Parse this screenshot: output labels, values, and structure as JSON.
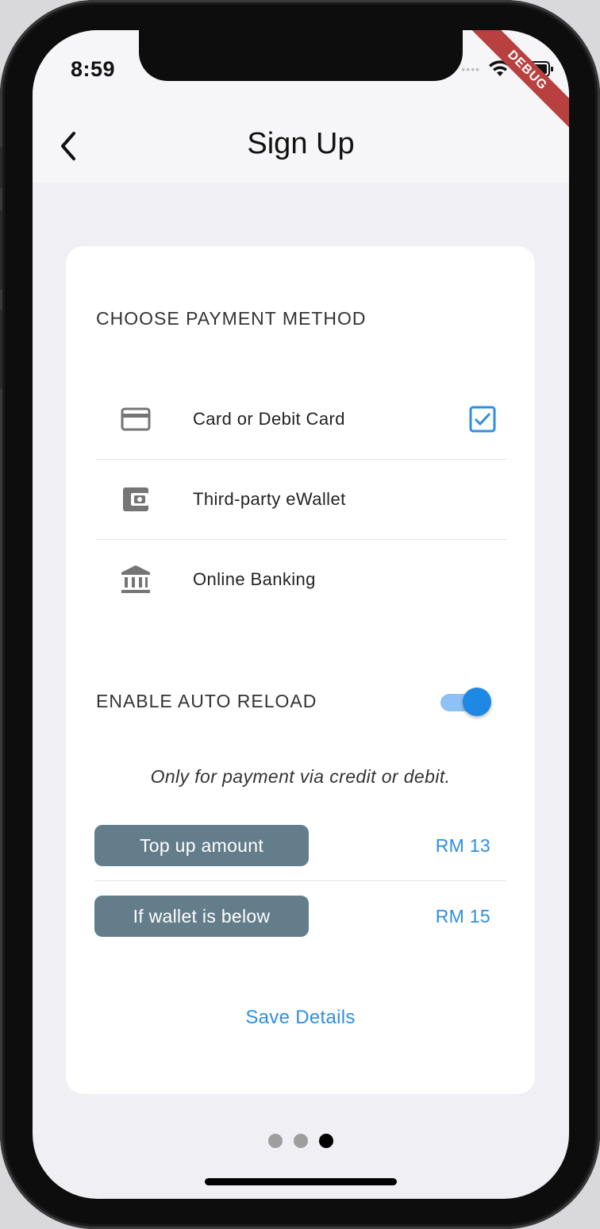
{
  "status_bar": {
    "time": "8:59",
    "debug_banner": "DEBUG"
  },
  "app_bar": {
    "title": "Sign Up",
    "back_icon": "chevron-left-icon"
  },
  "payment": {
    "section_title": "CHOOSE PAYMENT METHOD",
    "methods": [
      {
        "label": "Card or Debit Card",
        "icon": "credit-card-icon",
        "selected": true
      },
      {
        "label": "Third-party eWallet",
        "icon": "wallet-icon",
        "selected": false
      },
      {
        "label": "Online Banking",
        "icon": "bank-icon",
        "selected": false
      }
    ]
  },
  "auto_reload": {
    "title": "ENABLE AUTO RELOAD",
    "enabled": true,
    "note": "Only for payment via credit or debit.",
    "rows": [
      {
        "label": "Top up amount",
        "value": "RM 13"
      },
      {
        "label": "If wallet is below",
        "value": "RM 15"
      }
    ]
  },
  "save_label": "Save Details",
  "pager": {
    "total": 3,
    "active_index": 2
  },
  "colors": {
    "accent": "#2e8fe0",
    "chip": "#637d8b",
    "toggle": "#1e88e5",
    "debug": "#b8413f"
  }
}
